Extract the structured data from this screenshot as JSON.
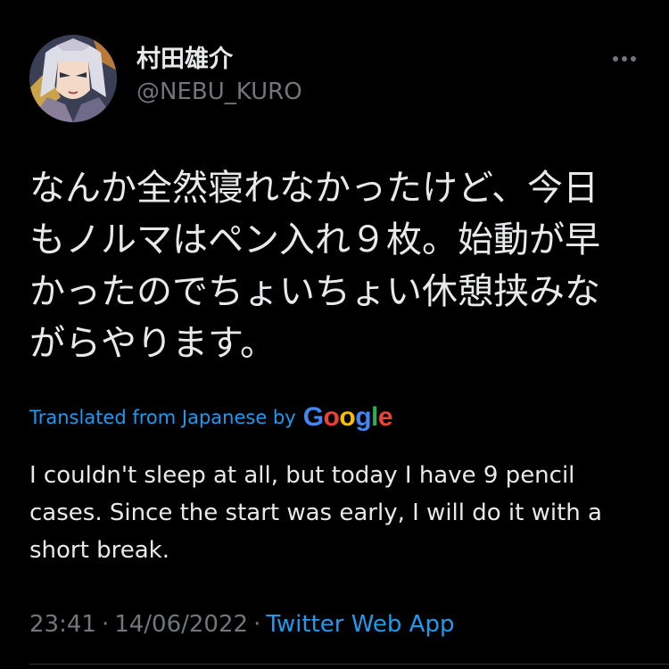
{
  "author": {
    "display_name": "村田雄介",
    "handle": "@NEBU_KURO"
  },
  "more_icon": "more-horizontal-icon",
  "tweet": {
    "text_lines": [
      "なんか全然寝れなかったけど、今日",
      "もノルマはペン入れ９枚。始動が早",
      "かったのでちょいちょい休憩挟みな",
      "がらやります。"
    ]
  },
  "translation": {
    "label": "Translated from Japanese by",
    "provider": "Google",
    "text_lines": [
      "I couldn't sleep at all, but today I have 9 pencil",
      "cases. Since the start was early, I will do it with a",
      "short break."
    ]
  },
  "meta": {
    "time": "23:41",
    "separator": "·",
    "date": "14/06/2022",
    "source": "Twitter Web App"
  },
  "colors": {
    "background": "#000000",
    "primary_text": "#e7e9ea",
    "secondary_text": "#71767b",
    "link": "#1d9bf0"
  }
}
